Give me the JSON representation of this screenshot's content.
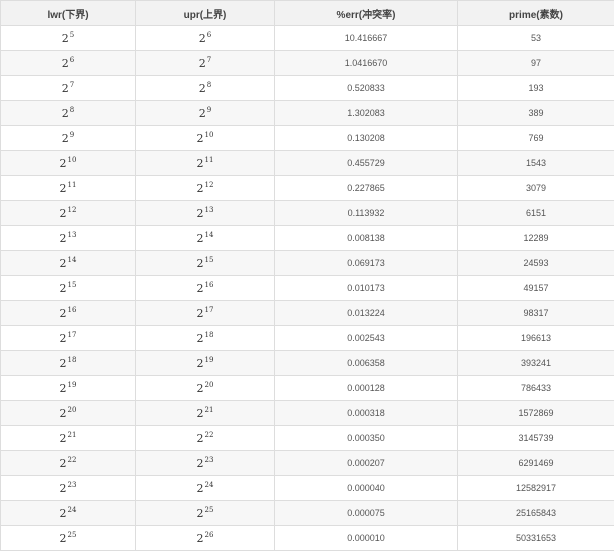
{
  "headers": {
    "lwr": "lwr(下界)",
    "upr": "upr(上界)",
    "err": "%err(冲突率)",
    "prime": "prime(素数)"
  },
  "base": "2",
  "rows": [
    {
      "lwr_exp": "5",
      "upr_exp": "6",
      "err": "10.416667",
      "prime": "53"
    },
    {
      "lwr_exp": "6",
      "upr_exp": "7",
      "err": "1.0416670",
      "prime": "97"
    },
    {
      "lwr_exp": "7",
      "upr_exp": "8",
      "err": "0.520833",
      "prime": "193"
    },
    {
      "lwr_exp": "8",
      "upr_exp": "9",
      "err": "1.302083",
      "prime": "389"
    },
    {
      "lwr_exp": "9",
      "upr_exp": "10",
      "err": "0.130208",
      "prime": "769"
    },
    {
      "lwr_exp": "10",
      "upr_exp": "11",
      "err": "0.455729",
      "prime": "1543"
    },
    {
      "lwr_exp": "11",
      "upr_exp": "12",
      "err": "0.227865",
      "prime": "3079"
    },
    {
      "lwr_exp": "12",
      "upr_exp": "13",
      "err": "0.113932",
      "prime": "6151"
    },
    {
      "lwr_exp": "13",
      "upr_exp": "14",
      "err": "0.008138",
      "prime": "12289"
    },
    {
      "lwr_exp": "14",
      "upr_exp": "15",
      "err": "0.069173",
      "prime": "24593"
    },
    {
      "lwr_exp": "15",
      "upr_exp": "16",
      "err": "0.010173",
      "prime": "49157"
    },
    {
      "lwr_exp": "16",
      "upr_exp": "17",
      "err": "0.013224",
      "prime": "98317"
    },
    {
      "lwr_exp": "17",
      "upr_exp": "18",
      "err": "0.002543",
      "prime": "196613"
    },
    {
      "lwr_exp": "18",
      "upr_exp": "19",
      "err": "0.006358",
      "prime": "393241"
    },
    {
      "lwr_exp": "19",
      "upr_exp": "20",
      "err": "0.000128",
      "prime": "786433"
    },
    {
      "lwr_exp": "20",
      "upr_exp": "21",
      "err": "0.000318",
      "prime": "1572869"
    },
    {
      "lwr_exp": "21",
      "upr_exp": "22",
      "err": "0.000350",
      "prime": "3145739"
    },
    {
      "lwr_exp": "22",
      "upr_exp": "23",
      "err": "0.000207",
      "prime": "6291469"
    },
    {
      "lwr_exp": "23",
      "upr_exp": "24",
      "err": "0.000040",
      "prime": "12582917"
    },
    {
      "lwr_exp": "24",
      "upr_exp": "25",
      "err": "0.000075",
      "prime": "25165843"
    },
    {
      "lwr_exp": "25",
      "upr_exp": "26",
      "err": "0.000010",
      "prime": "50331653"
    }
  ]
}
